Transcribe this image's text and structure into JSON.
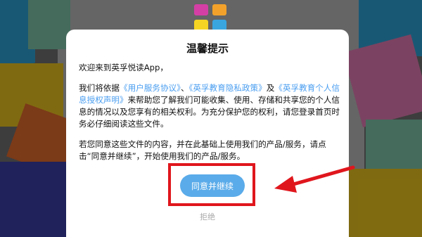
{
  "dialog": {
    "title": "温馨提示",
    "greeting": "欢迎来到英孚悦读App，",
    "p1_prefix": "我们将依据",
    "link_user_agreement": "《用户服务协议》",
    "sep1": "、",
    "link_privacy_policy": "《英孚教育隐私政策》",
    "sep2": "及",
    "link_personal_info_auth": "《英孚教育个人信息授权声明》",
    "p1_suffix": "来帮助您了解我们可能收集、使用、存储和共享您的个人信息的情况以及您享有的相关权利。为充分保护您的权利，请您登录首页时务必仔细阅读这些文件。",
    "p2": "若您同意这些文件的内容，并在此基础上使用我们的产品/服务，请点击“同意并继续”，开始使用我们的产品/服务。",
    "agree_button": "同意并继续",
    "reject_link": "拒绝"
  },
  "colors": {
    "link": "#4a9ef0",
    "agree_button": "#5aabe9",
    "annotation": "#e0161d"
  }
}
